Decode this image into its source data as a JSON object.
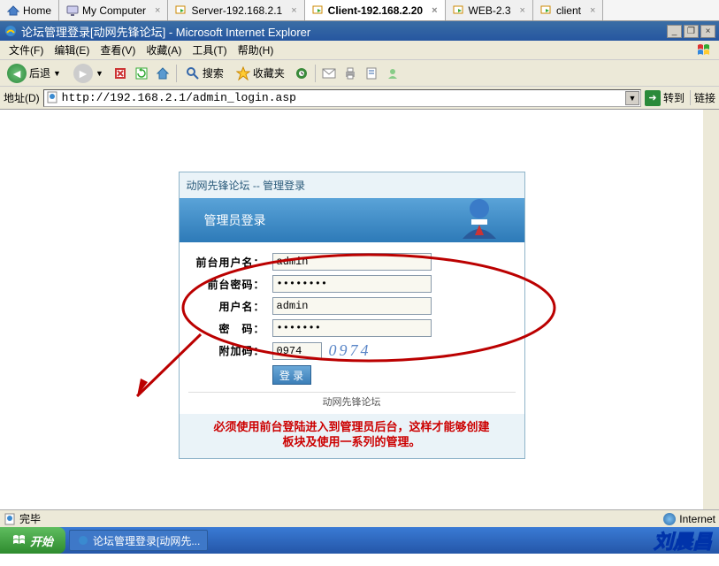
{
  "vm_tabs": [
    {
      "label": "Home",
      "icon": "home"
    },
    {
      "label": "My Computer",
      "icon": "my-computer"
    },
    {
      "label": "Server-192.168.2.1",
      "icon": "vm"
    },
    {
      "label": "Client-192.168.2.20",
      "icon": "vm",
      "active": true
    },
    {
      "label": "WEB-2.3",
      "icon": "vm"
    },
    {
      "label": "client",
      "icon": "vm"
    }
  ],
  "window": {
    "title": "论坛管理登录[动网先锋论坛] - Microsoft Internet Explorer"
  },
  "menu": {
    "file": "文件(F)",
    "edit": "编辑(E)",
    "view": "查看(V)",
    "fav": "收藏(A)",
    "tools": "工具(T)",
    "help": "帮助(H)"
  },
  "toolbar": {
    "back": "后退",
    "search": "搜索",
    "favorites": "收藏夹"
  },
  "address": {
    "label": "地址(D)",
    "url": "http://192.168.2.1/admin_login.asp",
    "go": "转到",
    "links": "链接"
  },
  "login": {
    "top_title": "动网先锋论坛 -- 管理登录",
    "header": "管理员登录",
    "labels": {
      "front_user": "前台用户名：",
      "front_pwd": "前台密码：",
      "user": "用户名：",
      "pwd": "密　码：",
      "captcha": "附加码："
    },
    "values": {
      "front_user": "admin",
      "front_pwd": "••••••••",
      "user": "admin",
      "pwd": "•••••••",
      "captcha": "0974"
    },
    "captcha_display": "0974",
    "button": "登 录",
    "footer": "动网先锋论坛"
  },
  "note": {
    "line1": "必须使用前台登陆进入到管理员后台，这样才能够创建",
    "line2": "板块及使用一系列的管理。"
  },
  "status": {
    "left": "完毕",
    "right": "Internet"
  },
  "taskbar": {
    "start": "开始",
    "task1": "论坛管理登录[动网先...",
    "watermark": "刘晨昌"
  }
}
